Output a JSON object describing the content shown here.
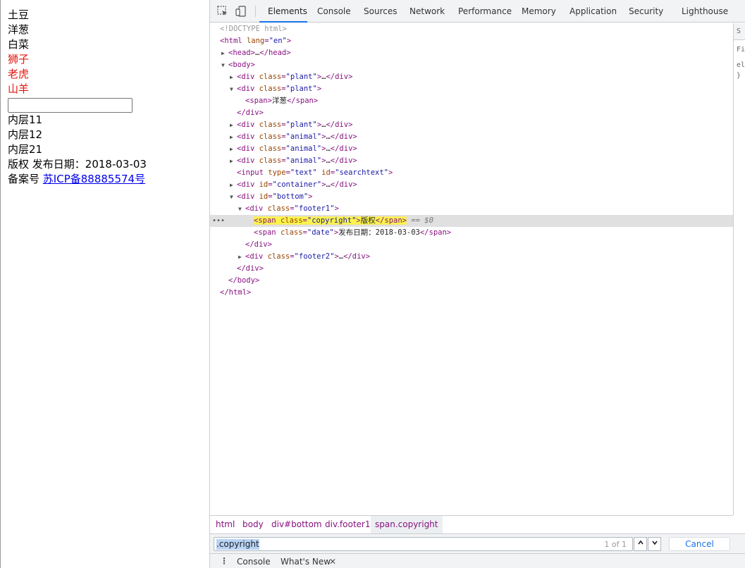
{
  "page": {
    "lines": [
      "土豆",
      "洋葱",
      "白菜",
      "狮子",
      "老虎",
      "山羊"
    ],
    "inner": [
      "内层11",
      "内层12",
      "内层21"
    ],
    "footer1_copyright": "版权",
    "footer1_date": "发布日期：2018-03-03",
    "footer2_label": "备案号",
    "footer2_link": "苏ICP备88885574号"
  },
  "toolbar": {
    "tabs": [
      "Elements",
      "Console",
      "Sources",
      "Network",
      "Performance",
      "Memory",
      "Application",
      "Security",
      "Lighthouse"
    ]
  },
  "tree": {
    "doctype": "<!DOCTYPE html>",
    "html_open_tag": "<html",
    "html_attr": "lang",
    "html_val": "\"en\"",
    "head": "head",
    "body": "body",
    "plant_val": "\"plant\"",
    "animal_val": "\"animal\"",
    "span_text": "洋葱",
    "input_type_val": "\"text\"",
    "input_id_val": "\"searchtext\"",
    "container_val": "\"container\"",
    "bottom_val": "\"bottom\"",
    "footer1_val": "\"footer1\"",
    "copyright_val": "\"copyright\"",
    "copyright_text": "版权",
    "date_val": "\"date\"",
    "date_text": "发布日期：2018-03-03",
    "footer2_val": "\"footer2\"",
    "eq_marker": "== $0"
  },
  "breadcrumbs": [
    "html",
    "body",
    "div#bottom",
    "div.footer1",
    "span.copyright"
  ],
  "search": {
    "value": ".copyright",
    "count": "1 of 1",
    "cancel": "Cancel"
  },
  "drawer": {
    "items": [
      "Console",
      "What's New"
    ]
  },
  "side_pane": {
    "lines": [
      "S",
      "Fi",
      "el",
      "}"
    ]
  },
  "colors": {
    "tag": "#881280",
    "attribute": "#994500",
    "value": "#1a1aa6",
    "highlight": "#fbf44d",
    "red_text": "#e3160c",
    "link": "#0000ee",
    "accent": "#1a73e8"
  }
}
